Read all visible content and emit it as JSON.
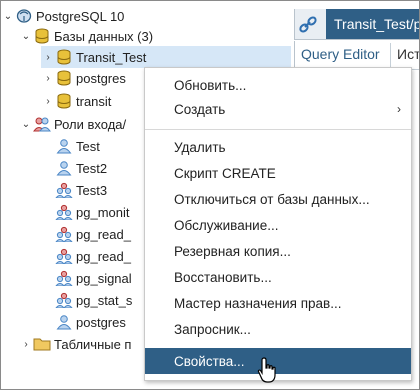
{
  "tree": {
    "server": "PostgreSQL 10",
    "databases": "Базы данных (3)",
    "db_items": [
      "Transit_Test",
      "postgres",
      "transit"
    ],
    "roles": "Роли входа/",
    "role_items": [
      "Test",
      "Test2",
      "Test3",
      "pg_monit",
      "pg_read_",
      "pg_read_",
      "pg_signal",
      "pg_stat_s",
      "postgres"
    ],
    "tablespaces": "Табличные п"
  },
  "panel": {
    "tab_title": "Transit_Test/p",
    "tabs": [
      "Query Editor",
      "Ист"
    ]
  },
  "menu": {
    "items": [
      "Обновить...",
      "Создать",
      "Удалить",
      "Скрипт CREATE",
      "Отключиться от базы данных...",
      "Обслуживание...",
      "Резервная копия...",
      "Восстановить...",
      "Мастер назначения прав...",
      "Запросник...",
      "Свойства..."
    ],
    "submenu_arrow": "›"
  },
  "colors": {
    "selection_bg": "#d6e7f7",
    "accent": "#2f5f86",
    "db_icon": "#c8a021",
    "role_icon": "#4a86c5"
  },
  "icons": {
    "server": "elephant-icon",
    "database": "database-icon",
    "role": "user-icon",
    "group_role": "group-icon",
    "tablespace": "folder-icon",
    "connection": "link-icon"
  }
}
